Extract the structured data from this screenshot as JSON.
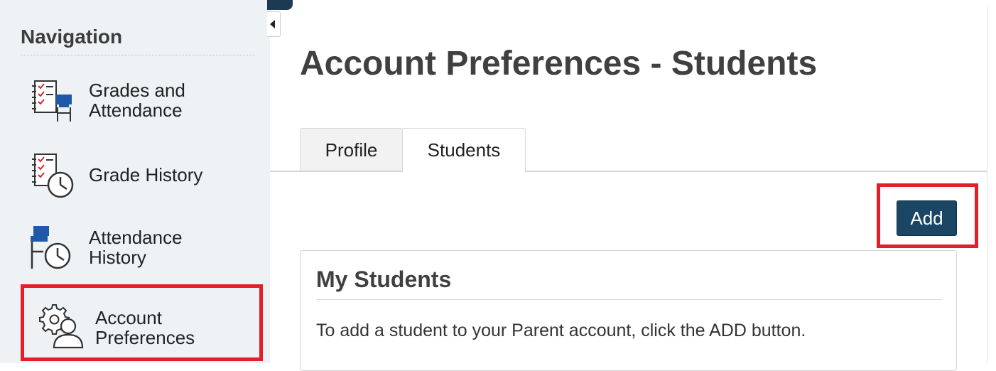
{
  "sidebar": {
    "title": "Navigation",
    "items": [
      {
        "id": "grades-attendance",
        "line1": "Grades and",
        "line2": "Attendance",
        "icon": "grades-attendance-icon"
      },
      {
        "id": "grade-history",
        "line1": "Grade History",
        "line2": "",
        "icon": "grade-history-icon"
      },
      {
        "id": "attendance-history",
        "line1": "Attendance",
        "line2": "History",
        "icon": "attendance-history-icon"
      },
      {
        "id": "account-preferences",
        "line1": "Account",
        "line2": "Preferences",
        "icon": "account-preferences-icon",
        "highlighted": true
      }
    ]
  },
  "main": {
    "page_title": "Account Preferences - Students",
    "tabs": [
      {
        "label": "Profile",
        "active": false
      },
      {
        "label": "Students",
        "active": true
      }
    ],
    "add_label": "Add",
    "panel": {
      "title": "My Students",
      "text": "To add a student to your Parent account, click the ADD button."
    }
  },
  "colors": {
    "highlight": "#e3202a",
    "button": "#1a4663",
    "sidebar_bg": "#eef2f5",
    "icon_blue": "#1f5aa8",
    "check_red": "#d62b2b"
  }
}
